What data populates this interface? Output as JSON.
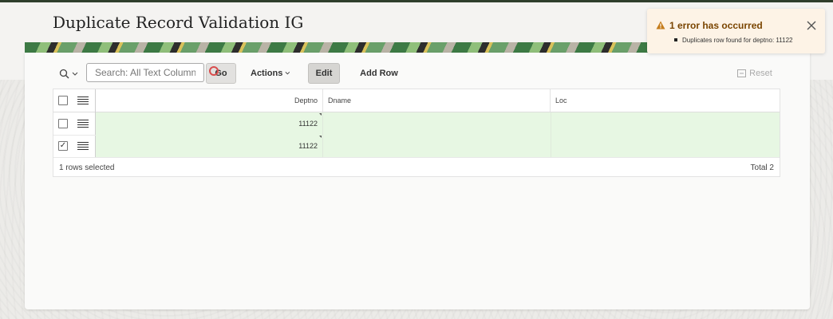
{
  "page": {
    "title": "Duplicate Record Validation IG"
  },
  "toolbar": {
    "search_icon": "search-icon",
    "search_placeholder": "Search: All Text Columns",
    "go_label": "Go",
    "actions_label": "Actions",
    "edit_label": "Edit",
    "add_row_label": "Add Row",
    "reset_label": "Reset"
  },
  "grid": {
    "columns": [
      "Deptno",
      "Dname",
      "Loc"
    ],
    "rows": [
      {
        "deptno": "11122",
        "dname": "",
        "loc": "",
        "checked": false
      },
      {
        "deptno": "11122",
        "dname": "",
        "loc": "",
        "checked": true
      }
    ],
    "footer": {
      "selected_text": "1 rows selected",
      "total_text": "Total 2"
    }
  },
  "alert": {
    "title": "1 error has occurred",
    "message": "Duplicates row found for deptno: 11122",
    "accent_color": "#c57c1b"
  },
  "colors": {
    "row_highlight": "#e7f7e3",
    "banner_green": "#3d7a45"
  }
}
